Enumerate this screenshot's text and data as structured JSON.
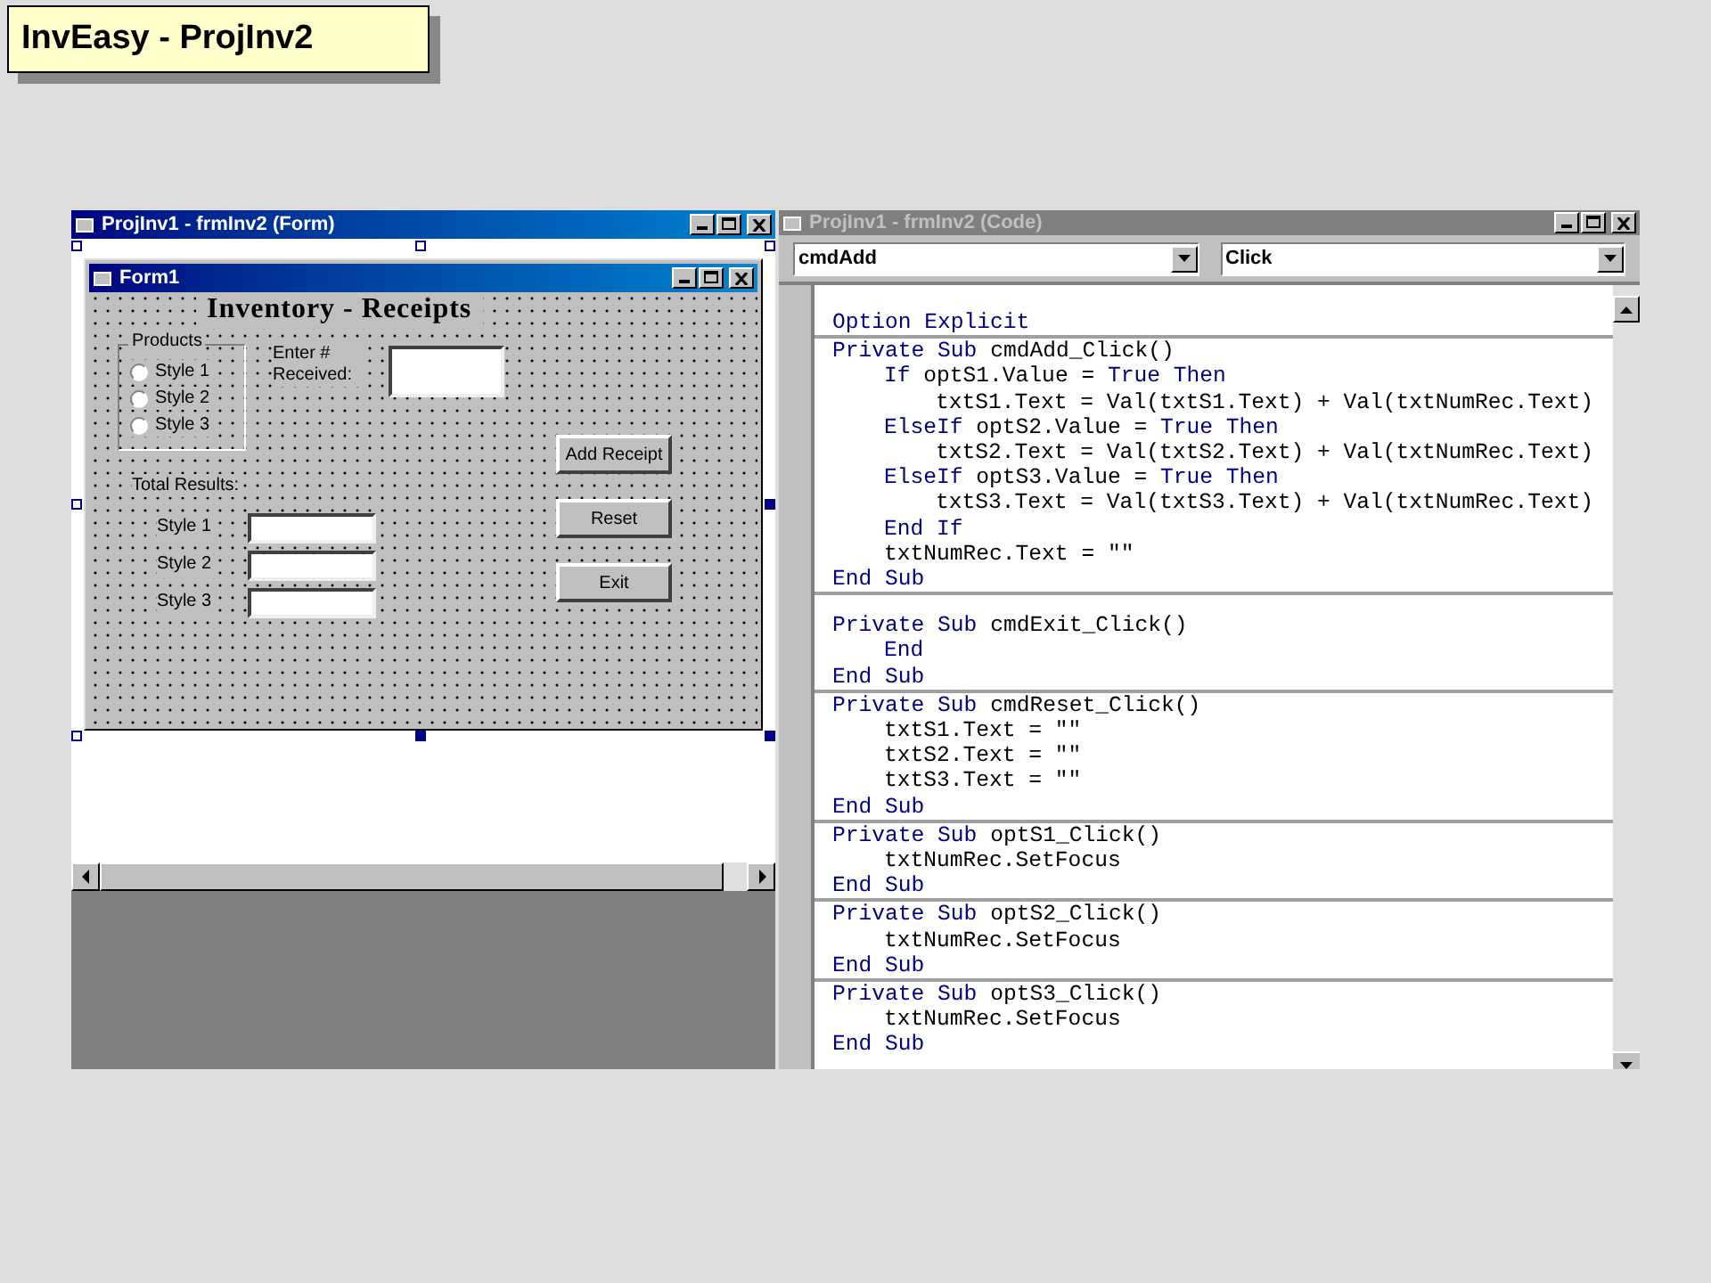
{
  "slide_title": "InvEasy - ProjInv2",
  "form_window": {
    "title": "ProjInv1 - frmInv2 (Form)",
    "form": {
      "title": "Form1",
      "heading": "Inventory - Receipts",
      "products": {
        "label": "Products",
        "options": [
          {
            "label": "Style 1",
            "selected": false
          },
          {
            "label": "Style 2",
            "selected": false
          },
          {
            "label": "Style 3",
            "selected": false
          }
        ]
      },
      "enter_label": "Enter # Received:",
      "total_label": "Total Results:",
      "totals": [
        "Style 1",
        "Style 2",
        "Style 3"
      ],
      "buttons": [
        "Add Receipt",
        "Reset",
        "Exit"
      ]
    }
  },
  "code_window": {
    "title": "ProjInv1 - frmInv2 (Code)",
    "object": "cmdAdd",
    "procedure": "Click",
    "blocks": [
      {
        "lines": [
          {
            "segs": [
              {
                "t": "Option Explicit",
                "kw": true
              }
            ]
          }
        ]
      },
      {
        "lines": [
          {
            "segs": [
              {
                "t": "Private Sub",
                "kw": true
              },
              {
                "t": " cmdAdd_Click()",
                "kw": false
              }
            ],
            "children": [
              {
                "segs": [
                  {
                    "t": "If",
                    "kw": true
                  },
                  {
                    "t": " optS1.Value = ",
                    "kw": false
                  },
                  {
                    "t": "True Then",
                    "kw": true
                  }
                ],
                "children": [
                  {
                    "segs": [
                      {
                        "t": "txtS1.Text = Val(txtS1.Text) + Val(txtNumRec.Text)",
                        "kw": false
                      }
                    ]
                  }
                ]
              },
              {
                "segs": [
                  {
                    "t": "ElseIf",
                    "kw": true
                  },
                  {
                    "t": " optS2.Value = ",
                    "kw": false
                  },
                  {
                    "t": "True Then",
                    "kw": true
                  }
                ],
                "children": [
                  {
                    "segs": [
                      {
                        "t": "txtS2.Text = Val(txtS2.Text) + Val(txtNumRec.Text)",
                        "kw": false
                      }
                    ]
                  }
                ]
              },
              {
                "segs": [
                  {
                    "t": "ElseIf",
                    "kw": true
                  },
                  {
                    "t": " optS3.Value = ",
                    "kw": false
                  },
                  {
                    "t": "True Then",
                    "kw": true
                  }
                ],
                "children": [
                  {
                    "segs": [
                      {
                        "t": "txtS3.Text = Val(txtS3.Text) + Val(txtNumRec.Text)",
                        "kw": false
                      }
                    ]
                  }
                ]
              },
              {
                "segs": [
                  {
                    "t": "End If",
                    "kw": true
                  }
                ]
              },
              {
                "segs": [
                  {
                    "t": "txtNumRec.Text = \"\"",
                    "kw": false
                  }
                ]
              }
            ]
          },
          {
            "segs": [
              {
                "t": "End Sub",
                "kw": true
              }
            ]
          }
        ]
      },
      {
        "gap_above": true,
        "lines": [
          {
            "segs": [
              {
                "t": "Private Sub",
                "kw": true
              },
              {
                "t": " cmdExit_Click()",
                "kw": false
              }
            ],
            "children": [
              {
                "segs": [
                  {
                    "t": "End",
                    "kw": true
                  }
                ]
              }
            ]
          },
          {
            "segs": [
              {
                "t": "End Sub",
                "kw": true
              }
            ]
          }
        ]
      },
      {
        "lines": [
          {
            "segs": [
              {
                "t": "Private Sub",
                "kw": true
              },
              {
                "t": " cmdReset_Click()",
                "kw": false
              }
            ],
            "children": [
              {
                "segs": [
                  {
                    "t": "txtS1.Text = \"\"",
                    "kw": false
                  }
                ]
              },
              {
                "segs": [
                  {
                    "t": "txtS2.Text = \"\"",
                    "kw": false
                  }
                ]
              },
              {
                "segs": [
                  {
                    "t": "txtS3.Text = \"\"",
                    "kw": false
                  }
                ]
              }
            ]
          },
          {
            "segs": [
              {
                "t": "End Sub",
                "kw": true
              }
            ]
          }
        ]
      },
      {
        "lines": [
          {
            "segs": [
              {
                "t": "Private Sub",
                "kw": true
              },
              {
                "t": " optS1_Click()",
                "kw": false
              }
            ],
            "children": [
              {
                "segs": [
                  {
                    "t": "txtNumRec.SetFocus",
                    "kw": false
                  }
                ]
              }
            ]
          },
          {
            "segs": [
              {
                "t": "End Sub",
                "kw": true
              }
            ]
          }
        ]
      },
      {
        "lines": [
          {
            "segs": [
              {
                "t": "Private Sub",
                "kw": true
              },
              {
                "t": " optS2_Click()",
                "kw": false
              }
            ],
            "children": [
              {
                "segs": [
                  {
                    "t": "txtNumRec.SetFocus",
                    "kw": false
                  }
                ]
              }
            ]
          },
          {
            "segs": [
              {
                "t": "End Sub",
                "kw": true
              }
            ]
          }
        ]
      },
      {
        "lines": [
          {
            "segs": [
              {
                "t": "Private Sub",
                "kw": true
              },
              {
                "t": " optS3_Click()",
                "kw": false
              }
            ],
            "children": [
              {
                "segs": [
                  {
                    "t": "txtNumRec.SetFocus",
                    "kw": false
                  }
                ]
              }
            ]
          },
          {
            "segs": [
              {
                "t": "End Sub",
                "kw": true
              }
            ]
          }
        ]
      }
    ]
  }
}
